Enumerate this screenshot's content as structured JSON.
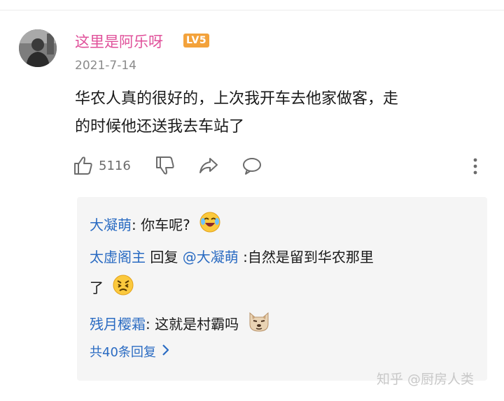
{
  "comment": {
    "username": "这里是阿乐呀",
    "level": "LV5",
    "date": "2021-7-14",
    "content_line1": "华农人真的很好的，上次我开车去他家做客，走",
    "content_line2": "的时候他还送我去车站了",
    "like_count": "5116"
  },
  "replies": [
    {
      "author": "大凝萌",
      "sep": ": ",
      "text": "你车呢?",
      "emoji": "laugh-cry-emoji"
    },
    {
      "author": "太虚阁主",
      "mid": " 回复 ",
      "mention": "@大凝萌",
      "text": " :自然是留到华农那里",
      "text2": "了",
      "emoji": "angry-face-emoji"
    },
    {
      "author": "残月樱霜",
      "sep": ": ",
      "text": "这就是村霸吗",
      "emoji": "dog-face-emoji"
    }
  ],
  "total_replies": "共40条回复",
  "watermark": "知乎 @厨房人类",
  "colors": {
    "username": "#e0509a",
    "link": "#2a6bc2",
    "badge": "#f3a23b",
    "panel": "#f5f5f5"
  }
}
